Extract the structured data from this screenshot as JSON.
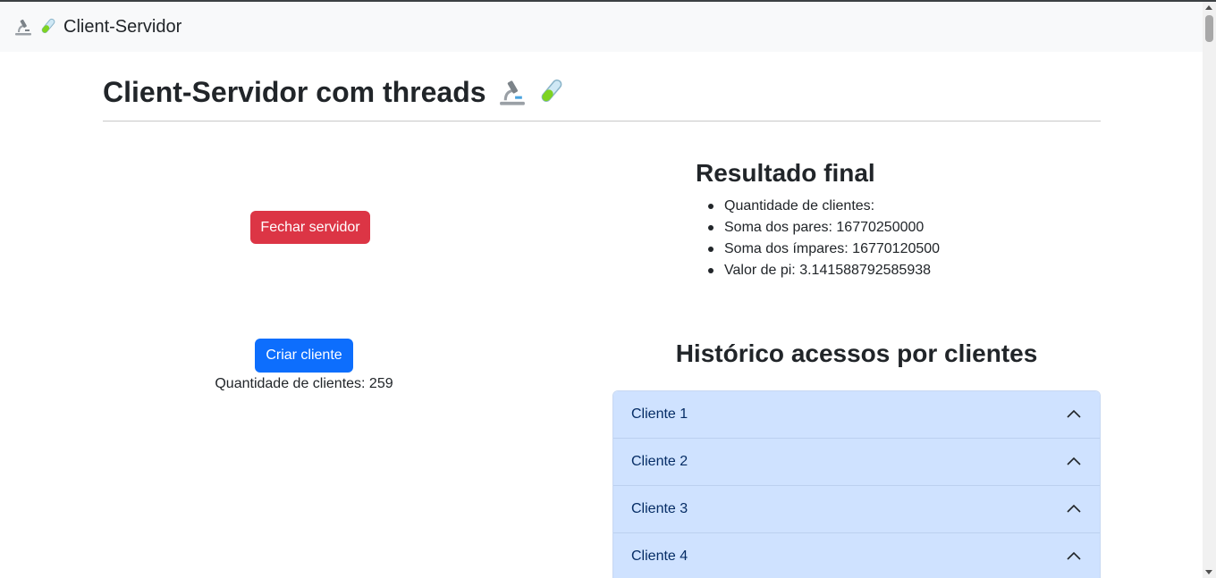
{
  "navbar": {
    "brand_label": "Client-Servidor",
    "icons": [
      "microscope-icon",
      "test-tube-icon"
    ]
  },
  "page": {
    "title": "Client-Servidor com threads"
  },
  "controls": {
    "close_server_label": "Fechar servidor",
    "create_client_label": "Criar cliente",
    "client_count_text": "Quantidade de clientes: 259"
  },
  "result": {
    "title": "Resultado final",
    "items": [
      "Quantidade de clientes:",
      "Soma dos pares: 16770250000",
      "Soma dos ímpares: 16770120500",
      "Valor de pi: 3.141588792585938"
    ]
  },
  "history": {
    "title": "Histórico acessos por clientes",
    "clients": [
      "Cliente 1",
      "Cliente 2",
      "Cliente 3",
      "Cliente 4"
    ]
  },
  "colors": {
    "danger": "#dc3545",
    "primary": "#0d6efd",
    "accordion_bg": "#cfe2ff",
    "navbar_bg": "#f8f9fa"
  }
}
